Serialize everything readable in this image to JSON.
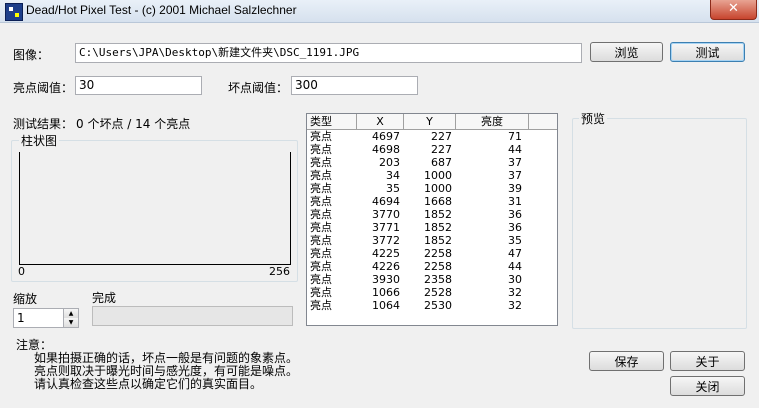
{
  "window": {
    "title": "Dead/Hot Pixel Test - (c) 2001 Michael Salzlechner",
    "close_symbol": "✕"
  },
  "image": {
    "label": "图像：",
    "path": "C:\\Users\\JPA\\Desktop\\新建文件夹\\DSC_1191.JPG"
  },
  "buttons": {
    "browse": "浏览",
    "test": "测试",
    "save": "保存",
    "about": "关于",
    "close": "关闭"
  },
  "thresholds": {
    "hot_label": "亮点阈值：",
    "hot_value": "30",
    "dead_label": "坏点阈值：",
    "dead_value": "300"
  },
  "result": {
    "label": "测试结果：",
    "text": "0 个坏点 / 14 个亮点"
  },
  "histogram": {
    "title": "柱状图",
    "min_label": "0",
    "max_label": "256"
  },
  "zoom": {
    "label": "缩放",
    "value": "1"
  },
  "progress": {
    "label": "完成",
    "fraction": 0
  },
  "preview": {
    "title": "预览"
  },
  "table": {
    "headers": [
      "类型",
      "X",
      "Y",
      "亮度"
    ],
    "rows": [
      [
        "亮点",
        "4697",
        "227",
        "71"
      ],
      [
        "亮点",
        "4698",
        "227",
        "44"
      ],
      [
        "亮点",
        "203",
        "687",
        "37"
      ],
      [
        "亮点",
        "34",
        "1000",
        "37"
      ],
      [
        "亮点",
        "35",
        "1000",
        "39"
      ],
      [
        "亮点",
        "4694",
        "1668",
        "31"
      ],
      [
        "亮点",
        "3770",
        "1852",
        "36"
      ],
      [
        "亮点",
        "3771",
        "1852",
        "36"
      ],
      [
        "亮点",
        "3772",
        "1852",
        "35"
      ],
      [
        "亮点",
        "4225",
        "2258",
        "47"
      ],
      [
        "亮点",
        "4226",
        "2258",
        "44"
      ],
      [
        "亮点",
        "3930",
        "2358",
        "30"
      ],
      [
        "亮点",
        "1066",
        "2528",
        "32"
      ],
      [
        "亮点",
        "1064",
        "2530",
        "32"
      ]
    ]
  },
  "notes": {
    "title": "注意：",
    "lines": [
      "如果拍摄正确的话，坏点一般是有问题的象素点。",
      "亮点则取决于曝光时间与感光度，有可能是噪点。",
      "请认真检查这些点以确定它们的真实面目。"
    ]
  }
}
